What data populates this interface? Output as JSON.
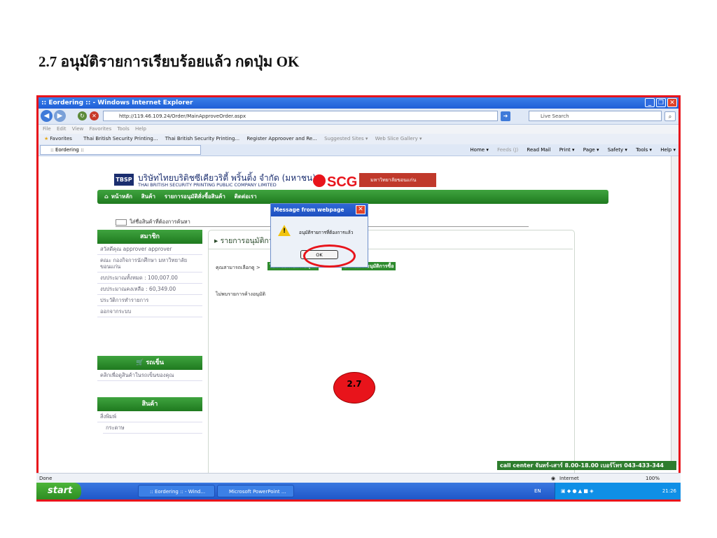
{
  "slide": {
    "heading": "2.7 อนุมัติรายการเรียบร้อยแล้ว กดปุ่ม OK",
    "marker": "2.7"
  },
  "browser": {
    "window_title": ":: Eordering :: - Windows Internet Explorer",
    "url": "http://119.46.109.24/Order/MainApproveOrder.aspx",
    "search_placeholder": "Live Search",
    "menu": [
      "File",
      "Edit",
      "View",
      "Favorites",
      "Tools",
      "Help"
    ],
    "favorites_label": "Favorites",
    "favorites": [
      "Thai British Security Printing...",
      "Thai British Security Printing...",
      "Register Approover and Re...",
      "Suggested Sites ▾",
      "Web Slice Gallery ▾"
    ],
    "tab_title": ":: Eordering ::",
    "commands": [
      "Home ▾",
      "Feeds (J)",
      "Read Mail",
      "Print ▾",
      "Page ▾",
      "Safety ▾",
      "Tools ▾",
      "Help ▾"
    ],
    "status_left": "Done",
    "status_zone": "Internet",
    "status_zoom": "100%"
  },
  "site": {
    "logo": "TBSP",
    "company_th": "บริษัทไทยบริติชซีเคียวริตี้ พริ้นติ้ง จำกัด (มหาชน)",
    "company_en": "THAI BRITISH SECURITY PRINTING PUBLIC COMPANY LIMITED",
    "scg": "SCG",
    "university": "มหาวิทยาลัยขอนแก่น",
    "nav": [
      "หน้าหลัก",
      "สินค้า",
      "รายการอนุมัติสั่งซื้อสินค้า",
      "ติดต่อเรา"
    ],
    "search_hint": "ใส่ชื่อสินค้าที่ต้องการค้นหา",
    "member": {
      "title": "สมาชิก",
      "items": [
        "สวัสดีคุณ approver approver",
        "คณะ กองกิจการนักศึกษา มหาวิทยาลัยขอนแก่น",
        "งบประมาณทั้งหมด : 100,007.00",
        "งบประมาณคงเหลือ : 60,349.00",
        "ประวัติการทำรายการ",
        "ออกจากระบบ"
      ]
    },
    "cart": {
      "title": "รถเข็น",
      "items": [
        "คลิกเพื่อดูสินค้าในรถเข็นของคุณ"
      ]
    },
    "products": {
      "title": "สินค้า",
      "items": [
        "สิ่งพิมพ์",
        "กระดาษ"
      ]
    },
    "panel_title": "รายการอนุมัติการสั่งซื้อของคุณ",
    "choose_label": "คุณสามารถเลือกดู >",
    "btn_orders": "ใบสั่งซื้อที่รอการอนุมัติ",
    "btn_history": "ประวัติการอนุมัติการซื้อ",
    "no_pending": "ไม่พบรายการค้างอนุมัติ",
    "call_center": "call center จันทร์-เสาร์ 8.00-18.00 เบอร์โทร 043-433-344"
  },
  "dialog": {
    "title": "Message from webpage",
    "message": "อนุมัติรายการที่ต้องการแล้ว",
    "ok": "OK"
  },
  "taskbar": {
    "start": "start",
    "tasks": [
      ":: Eordering :: - Wind...",
      "Microsoft PowerPoint ..."
    ],
    "lang": "EN",
    "clock": "21:26"
  }
}
